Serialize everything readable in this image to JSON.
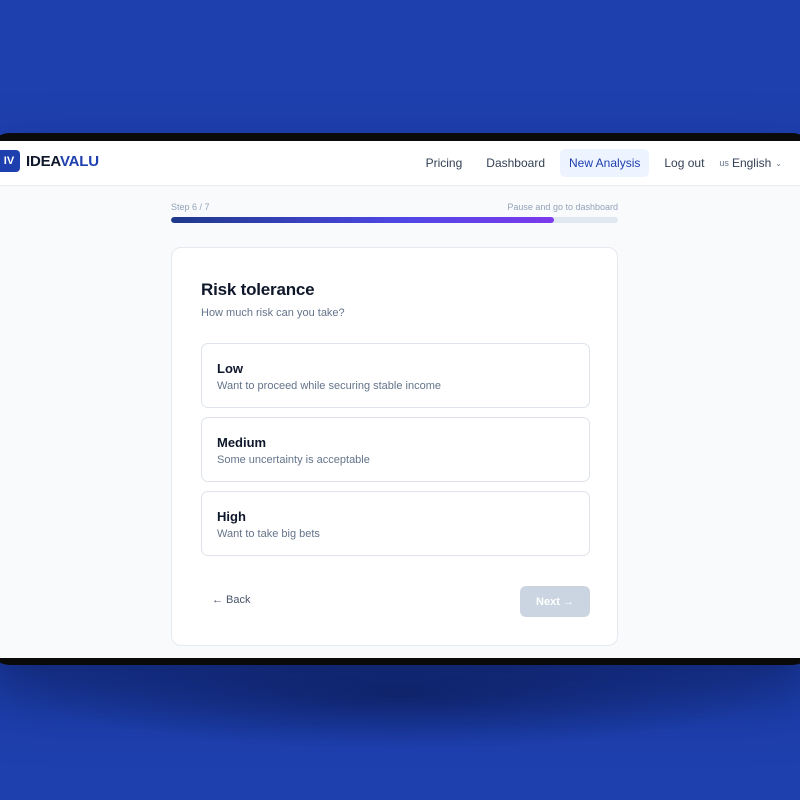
{
  "brand": {
    "mark": "IV",
    "name_part1": "IDEA",
    "name_part2": "VALU",
    "color": "#1e40af"
  },
  "nav": {
    "pricing": "Pricing",
    "dashboard": "Dashboard",
    "new_analysis": "New Analysis",
    "logout": "Log out",
    "lang_flag": "us",
    "lang_label": "English",
    "active": "New Analysis"
  },
  "progress": {
    "step_label": "Step 6 / 7",
    "pause_label": "Pause and go to dashboard",
    "value_fraction": 0.857
  },
  "card": {
    "title": "Risk tolerance",
    "subtitle": "How much risk can you take?",
    "options": [
      {
        "label": "Low",
        "description": "Want to proceed while securing stable income"
      },
      {
        "label": "Medium",
        "description": "Some uncertainty is acceptable"
      },
      {
        "label": "High",
        "description": "Want to take big bets"
      }
    ],
    "back_label": "← Back",
    "next_label": "Next →",
    "next_disabled": true
  },
  "colors": {
    "page_background": "#1e40af",
    "accent": "#1e40af",
    "progress_gradient_end": "#7c3aed",
    "disabled_button": "#cbd5e1"
  }
}
